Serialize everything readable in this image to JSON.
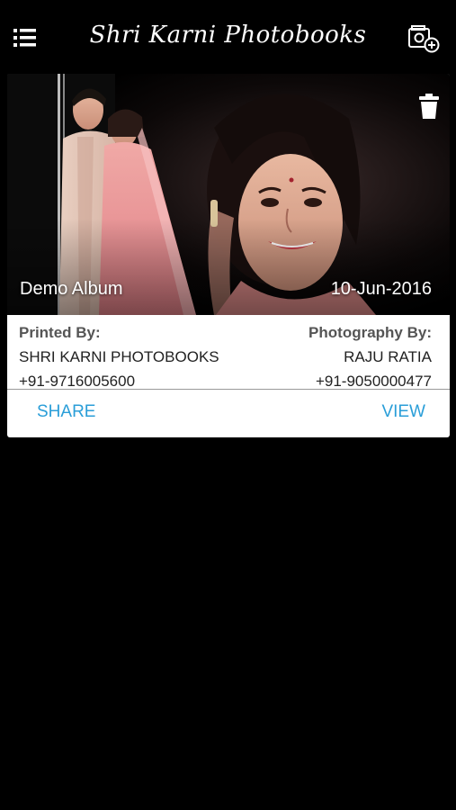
{
  "header": {
    "title": "Shri Karni Photobooks",
    "menu_icon": "list-menu-icon",
    "add_icon": "add-album-icon"
  },
  "album": {
    "name": "Demo Album",
    "date": "10-Jun-2016",
    "delete_icon": "trash-icon",
    "printed_by_label": "Printed By:",
    "printed_by_name": "SHRI KARNI PHOTOBOOKS",
    "printed_by_phone": "+91-9716005600",
    "photography_by_label": "Photography By:",
    "photography_by_name": "RAJU RATIA",
    "photography_by_phone": "+91-9050000477",
    "share_label": "SHARE",
    "view_label": "VIEW"
  },
  "colors": {
    "background": "#000000",
    "card": "#ffffff",
    "accent": "#2a9ed8"
  }
}
